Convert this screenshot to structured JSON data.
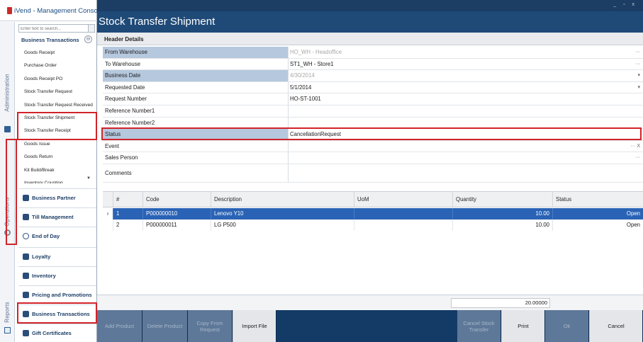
{
  "app": {
    "title": "iVend - Management Console",
    "window_controls": "_ ▫ x"
  },
  "window": {
    "title": "Stock Transfer Shipment"
  },
  "sidebar": {
    "search_placeholder": "Enter text to search...",
    "section_title": "Business Transactions",
    "collapse_glyph": "⊖",
    "items": [
      {
        "label": "Goods Receipt"
      },
      {
        "label": "Purchase Order"
      },
      {
        "label": "Goods Receipt PO"
      },
      {
        "label": "Stock Transfer Request"
      },
      {
        "label": "Stock Transfer Request Received"
      },
      {
        "label": "Stock Transfer Shipment"
      },
      {
        "label": "Stock Transfer Receipt"
      },
      {
        "label": "Goods Issue"
      },
      {
        "label": "Goods Return"
      },
      {
        "label": "Kit Build/Break"
      },
      {
        "label": "Inventory Counting"
      }
    ],
    "scroll_glyph": "▼",
    "vertical_labels": {
      "administration": "Administration",
      "operations": "Operations",
      "reports": "Reports"
    },
    "modules": [
      {
        "label": "Business Partner"
      },
      {
        "label": "Till Management"
      },
      {
        "label": "End of Day"
      },
      {
        "label": "Loyalty"
      },
      {
        "label": "Inventory"
      },
      {
        "label": "Pricing and Promotions"
      },
      {
        "label": "Business Transactions"
      },
      {
        "label": "Gift Certificates"
      }
    ]
  },
  "header_details": {
    "title": "Header Details",
    "fields": [
      {
        "label": "From Warehouse",
        "value": "HO_WH - Headoffice",
        "icon": "···",
        "disabled": true,
        "shaded": true
      },
      {
        "label": "To Warehouse",
        "value": "ST1_WH - Store1",
        "icon": "···",
        "disabled": false,
        "shaded": false
      },
      {
        "label": "Business Date",
        "value": "4/30/2014",
        "icon": "▾",
        "disabled": true,
        "shaded": true
      },
      {
        "label": "Requested Date",
        "value": "5/1/2014",
        "icon": "▾",
        "disabled": false,
        "shaded": false
      },
      {
        "label": "Request Number",
        "value": "HO-ST-1001",
        "icon": "",
        "disabled": false,
        "shaded": false
      },
      {
        "label": "Reference Number1",
        "value": "",
        "icon": "",
        "disabled": false,
        "shaded": false
      },
      {
        "label": "Reference Number2",
        "value": "",
        "icon": "",
        "disabled": false,
        "shaded": false
      },
      {
        "label": "Status",
        "value": "CancellationRequest",
        "icon": "",
        "disabled": false,
        "shaded": true
      },
      {
        "label": "Event",
        "value": "",
        "icon": "··· X",
        "disabled": false,
        "shaded": false
      },
      {
        "label": "Sales Person",
        "value": "",
        "icon": "···",
        "disabled": false,
        "shaded": false
      },
      {
        "label": "Comments",
        "value": "",
        "icon": "",
        "disabled": false,
        "shaded": false
      }
    ]
  },
  "lines": {
    "columns": [
      "#",
      "Code",
      "Description",
      "UoM",
      "Quantity",
      "Status"
    ],
    "rows": [
      {
        "num": "1",
        "code": "P000000010",
        "description": "Lenovo Y10",
        "uom": "",
        "quantity": "10.00",
        "status": "Open",
        "selected": true
      },
      {
        "num": "2",
        "code": "P000000011",
        "description": "LG P500",
        "uom": "",
        "quantity": "10.00",
        "status": "Open",
        "selected": false
      }
    ],
    "row_indicator": "›",
    "total_quantity": "20.00000"
  },
  "toolbar": {
    "buttons": [
      {
        "label": "Add Product",
        "enabled": false
      },
      {
        "label": "Delete Product",
        "enabled": false
      },
      {
        "label": "Copy From\nRequest",
        "enabled": false
      },
      {
        "label": "Import File",
        "enabled": true
      },
      {
        "label": "Cancel Stock\nTransfer",
        "enabled": false
      },
      {
        "label": "Print",
        "enabled": true
      },
      {
        "label": "Ok",
        "enabled": false
      },
      {
        "label": "Cancel",
        "enabled": true
      }
    ]
  },
  "colors": {
    "title_bar": "#1f4a78",
    "toolbar": "#143a66",
    "selection": "#2a63b5",
    "field_label_shade": "#b5c8de",
    "highlight_box": "#d2232a"
  }
}
